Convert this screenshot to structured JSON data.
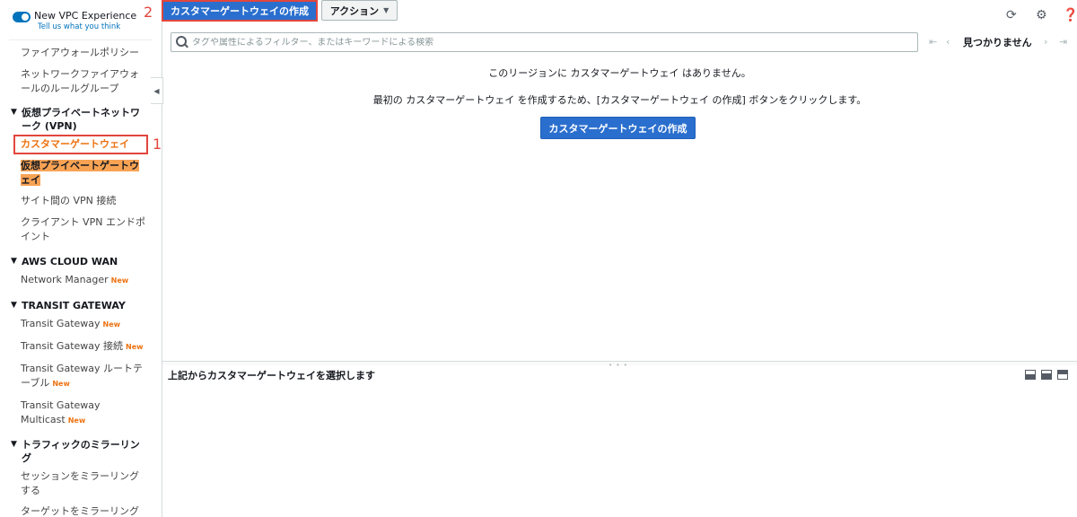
{
  "sidebar": {
    "vpc_title": "New VPC Experience",
    "vpc_link": "Tell us what you think",
    "items_top": [
      {
        "label": "ファイアウォールポリシー"
      },
      {
        "label": "ネットワークファイアウォールのルールグループ"
      }
    ],
    "vpn_section": "仮想プライベートネットワーク (VPN)",
    "vpn_items": [
      {
        "label": "カスタマーゲートウェイ",
        "active": true
      },
      {
        "label": "仮想プライベートゲートウェイ"
      },
      {
        "label": "サイト間の VPN 接続"
      },
      {
        "label": "クライアント VPN エンドポイント"
      }
    ],
    "wan_section": "AWS CLOUD WAN",
    "wan_items": [
      {
        "label": "Network Manager",
        "badge": "New"
      }
    ],
    "tgw_section": "TRANSIT GATEWAY",
    "tgw_items": [
      {
        "label": "Transit Gateway",
        "badge": "New"
      },
      {
        "label": "Transit Gateway 接続",
        "badge": "New"
      },
      {
        "label": "Transit Gateway ルートテーブル",
        "badge": "New"
      },
      {
        "label": "Transit Gateway Multicast",
        "badge": "New"
      }
    ],
    "mirror_section": "トラフィックのミラーリング",
    "mirror_items": [
      {
        "label": "セッションをミラーリングする"
      },
      {
        "label": "ターゲットをミラーリング"
      }
    ],
    "markers": {
      "step1": "1",
      "step2": "2"
    }
  },
  "toolbar": {
    "create_label": "カスタマーゲートウェイの作成",
    "action_label": "アクション",
    "refresh_icon": "refresh-icon",
    "settings_icon": "gear-icon"
  },
  "search": {
    "placeholder": "タグや属性によるフィルター、またはキーワードによる検索",
    "value": ""
  },
  "pager": {
    "status": "見つかりません"
  },
  "main": {
    "empty_message": "このリージョンに カスタマーゲートウェイ はありません。",
    "instruction": "最初の カスタマーゲートウェイ を作成するため、[カスタマーゲートウェイ の作成] ボタンをクリックします。",
    "create_label": "カスタマーゲートウェイの作成"
  },
  "detail": {
    "title": "上記からカスタマーゲートウェイを選択します"
  },
  "colors": {
    "primary": "#2b6fce",
    "highlight": "#f8a354",
    "annotation": "#e2463d",
    "new_badge": "#ec7211"
  }
}
